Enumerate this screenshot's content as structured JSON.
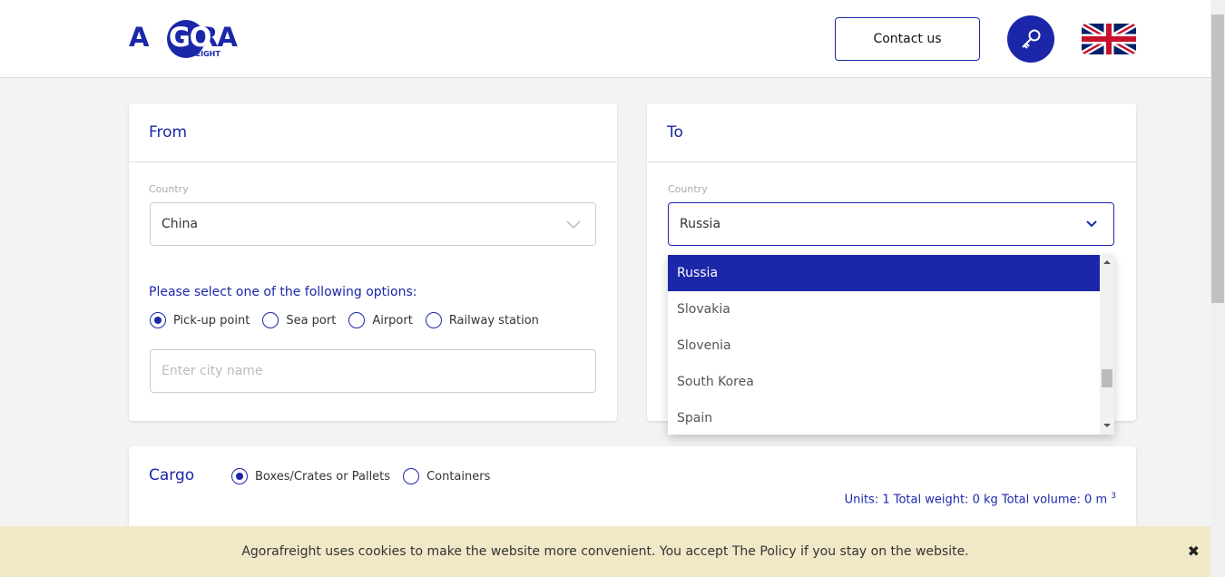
{
  "header": {
    "logo_text": "AGORA",
    "logo_sub": "FREIGHT",
    "contact_label": "Contact us",
    "login_icon": "key-icon",
    "language_icon": "uk-flag-icon"
  },
  "from": {
    "title": "From",
    "country_label": "Country",
    "country_value": "China",
    "options_label": "Please select one of the following options:",
    "options": [
      "Pick-up point",
      "Sea port",
      "Airport",
      "Railway station"
    ],
    "selected_option": 0,
    "city_placeholder": "Enter city name"
  },
  "to": {
    "title": "To",
    "country_label": "Country",
    "country_value": "Russia",
    "dropdown": [
      "Russia",
      "Slovakia",
      "Slovenia",
      "South Korea",
      "Spain"
    ]
  },
  "cargo": {
    "title": "Cargo",
    "options": [
      "Boxes/Crates or Pallets",
      "Containers"
    ],
    "selected_option": 0,
    "summary": "Units: 1 Total weight: 0 kg Total volume: 0 m",
    "summary_sup": "3"
  },
  "cookie": {
    "text": "Agorafreight uses cookies to make the website more convenient. You accept The Policy if you stay on the website.",
    "close": "✖"
  },
  "colors": {
    "accent": "#1b27a8"
  }
}
